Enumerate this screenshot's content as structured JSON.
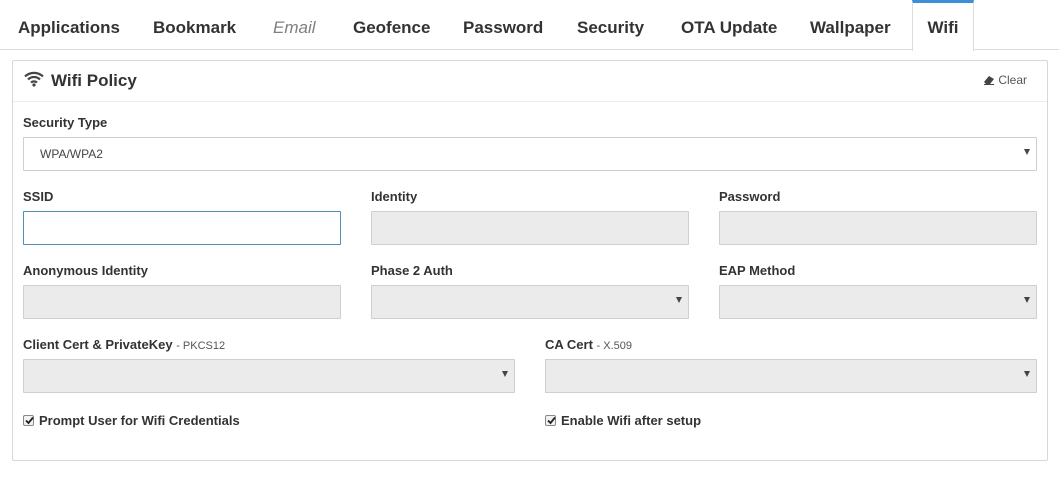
{
  "tabs": [
    {
      "label": "Applications"
    },
    {
      "label": "Bookmark"
    },
    {
      "label": "Email"
    },
    {
      "label": "Geofence"
    },
    {
      "label": "Password"
    },
    {
      "label": "Security"
    },
    {
      "label": "OTA Update"
    },
    {
      "label": "Wallpaper"
    },
    {
      "label": "Wifi"
    }
  ],
  "panel": {
    "icon": "wifi-icon",
    "title": "Wifi Policy",
    "clear_label": "Clear",
    "clear_icon": "eraser-icon"
  },
  "form": {
    "security_type": {
      "label": "Security Type",
      "value": "WPA/WPA2"
    },
    "ssid": {
      "label": "SSID",
      "value": ""
    },
    "identity": {
      "label": "Identity",
      "value": ""
    },
    "password": {
      "label": "Password",
      "value": ""
    },
    "anonymous_identity": {
      "label": "Anonymous Identity",
      "value": ""
    },
    "phase2_auth": {
      "label": "Phase 2 Auth",
      "value": ""
    },
    "eap_method": {
      "label": "EAP Method",
      "value": ""
    },
    "client_cert": {
      "label": "Client Cert & PrivateKey",
      "hint": "- PKCS12",
      "value": ""
    },
    "ca_cert": {
      "label": "CA Cert",
      "hint": "- X.509",
      "value": ""
    },
    "prompt_user": {
      "label": "Prompt User for Wifi Credentials",
      "checked": true
    },
    "enable_wifi": {
      "label": "Enable Wifi after setup",
      "checked": true
    }
  },
  "colors": {
    "accent": "#3b8fd6",
    "disabled_field": "#ebebeb",
    "focus_border": "#4f8fb8"
  }
}
